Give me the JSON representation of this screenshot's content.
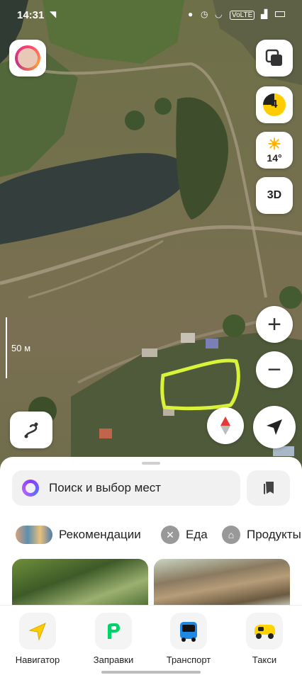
{
  "status_bar": {
    "time": "14:31",
    "network": "VoLTE"
  },
  "map": {
    "speed_value": "4",
    "weather_temp": "14°",
    "mode_3d_label": "3D",
    "zoom_in_label": "+",
    "zoom_out_label": "−",
    "scale_label": "50 м"
  },
  "sheet": {
    "search_placeholder": "Поиск и выбор мест",
    "categories": [
      {
        "label": "Рекомендации",
        "icon": "recommendations-icon"
      },
      {
        "label": "Еда",
        "icon": "food-icon"
      },
      {
        "label": "Продукты",
        "icon": "basket-icon"
      }
    ]
  },
  "nav": {
    "items": [
      {
        "label": "Навигатор",
        "icon": "navigator-icon"
      },
      {
        "label": "Заправки",
        "icon": "fuel-icon"
      },
      {
        "label": "Транспорт",
        "icon": "bus-icon"
      },
      {
        "label": "Такси",
        "icon": "taxi-icon"
      }
    ]
  },
  "colors": {
    "highlight": "#d9f23a",
    "compass_red": "#e53935",
    "speed_yellow": "#ffcc00",
    "alice_purple": "#8a3ffc"
  }
}
